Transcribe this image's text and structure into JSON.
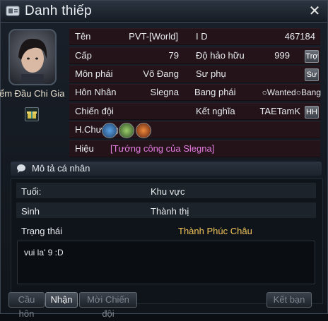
{
  "window": {
    "title": "Danh thiếp"
  },
  "profile": {
    "character_name": "ểm Đầu Chi Giao",
    "fields": {
      "name_label": "Tên",
      "name_value": "PVT-[World]",
      "id_label": "I D",
      "id_value": "467184",
      "level_label": "Cấp",
      "level_value": "79",
      "friendship_label": "Độ hảo hữu",
      "friendship_value": "999",
      "friendship_btn": "Trợ",
      "sect_label": "Môn phái",
      "sect_value": "Võ Đang",
      "master_label": "Sư phụ",
      "master_btn": "Sư",
      "marriage_label": "Hôn Nhân",
      "marriage_value": "Slegna",
      "guild_label": "Bang phái",
      "guild_value": "○Wanted○Bang",
      "team_label": "Chiến đội",
      "brother_label": "Kết nghĩa",
      "brother_value": "TAETamK",
      "brother_btn": "HH",
      "badge_label": "H.Chương",
      "title_label": "Hiệu",
      "title_value": "[Tướng công của Slegna]"
    }
  },
  "description": {
    "header": "Mô tả cá nhân",
    "age_label": "Tuổi:",
    "region_label": "Khu vực",
    "birth_label": "Sinh",
    "city_label": "Thành thị",
    "status_label": "Trạng thái",
    "status_value": "Thành Phúc Châu",
    "bio": "vui la' 9 :D"
  },
  "buttons": {
    "propose": "Cầu hôn",
    "accept": "Nhận",
    "invite_team": "Mời Chiến đội",
    "add_friend": "Kết bạn"
  },
  "colors": {
    "title_purple": "#e57be3",
    "status_gold": "#f0c35a",
    "row_bg": "#241419"
  },
  "icons": [
    "card-icon",
    "close-icon",
    "gift-icon",
    "badge-icon-blue",
    "badge-icon-green",
    "badge-icon-orange",
    "speech-icon"
  ]
}
